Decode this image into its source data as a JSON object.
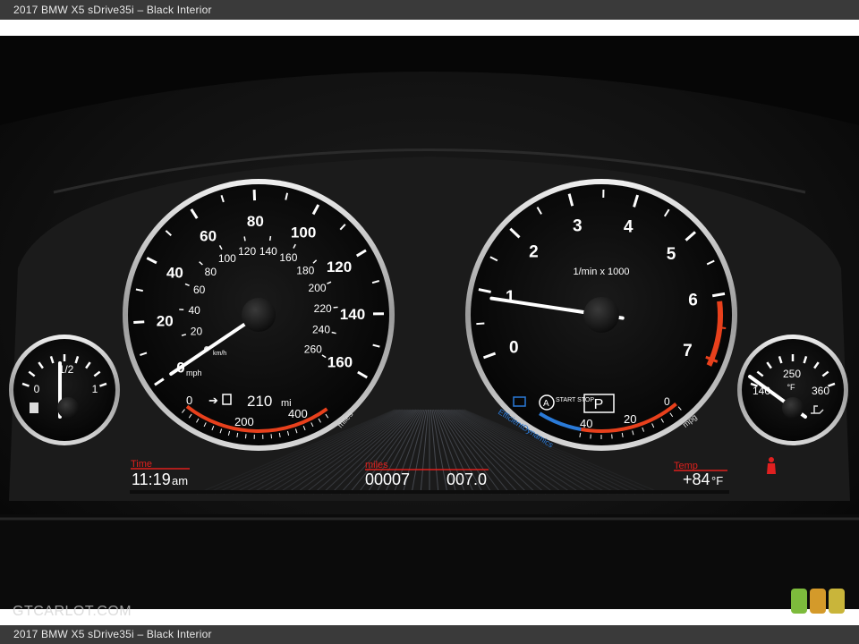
{
  "header": {
    "caption": "2017 BMW X5 sDrive35i – Black Interior"
  },
  "footer": {
    "caption": "2017 BMW X5 sDrive35i – Black Interior"
  },
  "watermark": {
    "text": "GTCARLOT.COM",
    "swatch_colors": [
      "#7dbb3c",
      "#d49a2a",
      "#c9b53a"
    ]
  },
  "speedometer": {
    "mph_labels": [
      "0",
      "20",
      "40",
      "60",
      "80",
      "100",
      "120",
      "140",
      "160"
    ],
    "mph_unit": "mph",
    "kmh_labels": [
      "20",
      "40",
      "60",
      "80",
      "100",
      "120",
      "140",
      "160",
      "180",
      "200",
      "220",
      "240",
      "260"
    ],
    "kmh_unit": "km/h",
    "needle_value_mph": 0,
    "range": {
      "arrow_text": "210",
      "unit": "mi",
      "scale_labels": [
        "0",
        "200",
        "400"
      ],
      "scale_unit": "miles"
    }
  },
  "tachometer": {
    "labels": [
      "0",
      "1",
      "2",
      "3",
      "4",
      "5",
      "6",
      "7"
    ],
    "unit_label": "1/min x 1000",
    "needle_value": 0.9,
    "start_stop_label": "START STOP",
    "gear": "P",
    "mpg_scale": [
      "40",
      "20",
      "0"
    ],
    "mpg_unit": "mpg",
    "eco_label": "EfficientDynamics"
  },
  "fuel_gauge": {
    "labels": [
      "0",
      "1/2",
      "1"
    ],
    "level_fraction": 0.48
  },
  "temp_gauge": {
    "labels": [
      "140",
      "250",
      "360"
    ],
    "unit": "°F"
  },
  "info_display": {
    "time_label": "Time",
    "time_value": "11:19",
    "time_suffix": "am",
    "miles_label": "miles",
    "odometer": "00007",
    "trip": "007.0",
    "temp_label": "Temp",
    "temp_value": "+84",
    "temp_unit": "°F"
  },
  "colors": {
    "needle": "#ffffff",
    "redline": "#e8401c",
    "info_label": "#e0201c",
    "eco_blue": "#2a7ad8",
    "seatbelt": "#e02020"
  }
}
